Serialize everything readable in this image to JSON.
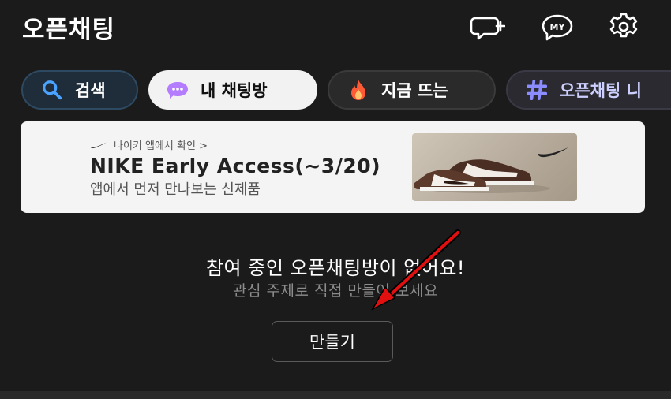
{
  "header": {
    "title": "오픈채팅",
    "icons": [
      "chat-add-icon",
      "my-profile-icon",
      "settings-gear-icon"
    ],
    "my_label": "MY"
  },
  "chips": [
    {
      "label": "검색",
      "icon": "search-icon"
    },
    {
      "label": "내 채팅방",
      "icon": "chat-bubble-icon",
      "selected": true
    },
    {
      "label": "지금 뜨는",
      "icon": "fire-icon"
    },
    {
      "label": "오픈채팅 니",
      "icon": "hashtag-icon"
    }
  ],
  "ad": {
    "source": "나이키 앱에서 확인 >",
    "headline": "NIKE Early Access(~3/20)",
    "subtext": "앱에서 먼저 만나보는 신제품",
    "image": "sneaker-image"
  },
  "empty_state": {
    "title": "참여 중인 오픈채팅방이 없어요!",
    "subtitle": "관심 주제로 직접 만들어 보세요",
    "button_label": "만들기"
  },
  "colors": {
    "background": "#1b1b1b",
    "arrow": "#e01010",
    "chip_tag_text": "#cdd0ff"
  }
}
